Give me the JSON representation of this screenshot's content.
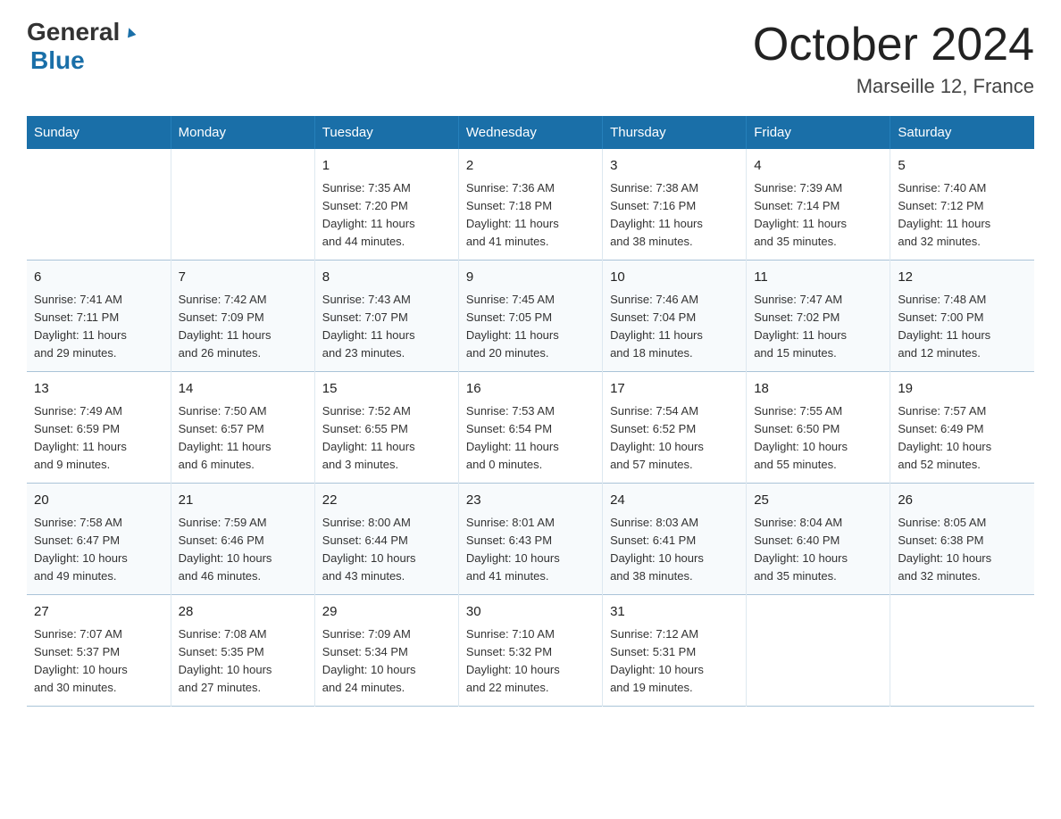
{
  "header": {
    "logo_general": "General",
    "logo_blue": "Blue",
    "title": "October 2024",
    "location": "Marseille 12, France"
  },
  "weekdays": [
    "Sunday",
    "Monday",
    "Tuesday",
    "Wednesday",
    "Thursday",
    "Friday",
    "Saturday"
  ],
  "weeks": [
    [
      {
        "day": "",
        "info": ""
      },
      {
        "day": "",
        "info": ""
      },
      {
        "day": "1",
        "info": "Sunrise: 7:35 AM\nSunset: 7:20 PM\nDaylight: 11 hours\nand 44 minutes."
      },
      {
        "day": "2",
        "info": "Sunrise: 7:36 AM\nSunset: 7:18 PM\nDaylight: 11 hours\nand 41 minutes."
      },
      {
        "day": "3",
        "info": "Sunrise: 7:38 AM\nSunset: 7:16 PM\nDaylight: 11 hours\nand 38 minutes."
      },
      {
        "day": "4",
        "info": "Sunrise: 7:39 AM\nSunset: 7:14 PM\nDaylight: 11 hours\nand 35 minutes."
      },
      {
        "day": "5",
        "info": "Sunrise: 7:40 AM\nSunset: 7:12 PM\nDaylight: 11 hours\nand 32 minutes."
      }
    ],
    [
      {
        "day": "6",
        "info": "Sunrise: 7:41 AM\nSunset: 7:11 PM\nDaylight: 11 hours\nand 29 minutes."
      },
      {
        "day": "7",
        "info": "Sunrise: 7:42 AM\nSunset: 7:09 PM\nDaylight: 11 hours\nand 26 minutes."
      },
      {
        "day": "8",
        "info": "Sunrise: 7:43 AM\nSunset: 7:07 PM\nDaylight: 11 hours\nand 23 minutes."
      },
      {
        "day": "9",
        "info": "Sunrise: 7:45 AM\nSunset: 7:05 PM\nDaylight: 11 hours\nand 20 minutes."
      },
      {
        "day": "10",
        "info": "Sunrise: 7:46 AM\nSunset: 7:04 PM\nDaylight: 11 hours\nand 18 minutes."
      },
      {
        "day": "11",
        "info": "Sunrise: 7:47 AM\nSunset: 7:02 PM\nDaylight: 11 hours\nand 15 minutes."
      },
      {
        "day": "12",
        "info": "Sunrise: 7:48 AM\nSunset: 7:00 PM\nDaylight: 11 hours\nand 12 minutes."
      }
    ],
    [
      {
        "day": "13",
        "info": "Sunrise: 7:49 AM\nSunset: 6:59 PM\nDaylight: 11 hours\nand 9 minutes."
      },
      {
        "day": "14",
        "info": "Sunrise: 7:50 AM\nSunset: 6:57 PM\nDaylight: 11 hours\nand 6 minutes."
      },
      {
        "day": "15",
        "info": "Sunrise: 7:52 AM\nSunset: 6:55 PM\nDaylight: 11 hours\nand 3 minutes."
      },
      {
        "day": "16",
        "info": "Sunrise: 7:53 AM\nSunset: 6:54 PM\nDaylight: 11 hours\nand 0 minutes."
      },
      {
        "day": "17",
        "info": "Sunrise: 7:54 AM\nSunset: 6:52 PM\nDaylight: 10 hours\nand 57 minutes."
      },
      {
        "day": "18",
        "info": "Sunrise: 7:55 AM\nSunset: 6:50 PM\nDaylight: 10 hours\nand 55 minutes."
      },
      {
        "day": "19",
        "info": "Sunrise: 7:57 AM\nSunset: 6:49 PM\nDaylight: 10 hours\nand 52 minutes."
      }
    ],
    [
      {
        "day": "20",
        "info": "Sunrise: 7:58 AM\nSunset: 6:47 PM\nDaylight: 10 hours\nand 49 minutes."
      },
      {
        "day": "21",
        "info": "Sunrise: 7:59 AM\nSunset: 6:46 PM\nDaylight: 10 hours\nand 46 minutes."
      },
      {
        "day": "22",
        "info": "Sunrise: 8:00 AM\nSunset: 6:44 PM\nDaylight: 10 hours\nand 43 minutes."
      },
      {
        "day": "23",
        "info": "Sunrise: 8:01 AM\nSunset: 6:43 PM\nDaylight: 10 hours\nand 41 minutes."
      },
      {
        "day": "24",
        "info": "Sunrise: 8:03 AM\nSunset: 6:41 PM\nDaylight: 10 hours\nand 38 minutes."
      },
      {
        "day": "25",
        "info": "Sunrise: 8:04 AM\nSunset: 6:40 PM\nDaylight: 10 hours\nand 35 minutes."
      },
      {
        "day": "26",
        "info": "Sunrise: 8:05 AM\nSunset: 6:38 PM\nDaylight: 10 hours\nand 32 minutes."
      }
    ],
    [
      {
        "day": "27",
        "info": "Sunrise: 7:07 AM\nSunset: 5:37 PM\nDaylight: 10 hours\nand 30 minutes."
      },
      {
        "day": "28",
        "info": "Sunrise: 7:08 AM\nSunset: 5:35 PM\nDaylight: 10 hours\nand 27 minutes."
      },
      {
        "day": "29",
        "info": "Sunrise: 7:09 AM\nSunset: 5:34 PM\nDaylight: 10 hours\nand 24 minutes."
      },
      {
        "day": "30",
        "info": "Sunrise: 7:10 AM\nSunset: 5:32 PM\nDaylight: 10 hours\nand 22 minutes."
      },
      {
        "day": "31",
        "info": "Sunrise: 7:12 AM\nSunset: 5:31 PM\nDaylight: 10 hours\nand 19 minutes."
      },
      {
        "day": "",
        "info": ""
      },
      {
        "day": "",
        "info": ""
      }
    ]
  ]
}
